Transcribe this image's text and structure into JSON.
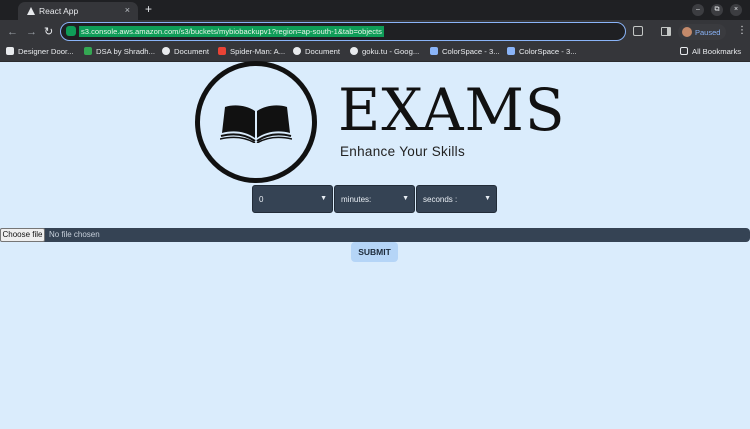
{
  "browser": {
    "tab": {
      "title": "React App",
      "close": "×"
    },
    "new_tab": "+",
    "window": {
      "minimize": "–",
      "restore": "⧉",
      "close": "×"
    },
    "address_bar": {
      "url": "s3.console.aws.amazon.com/s3/buckets/mybiobackupv1?region=ap-south-1&tab=objects"
    },
    "profile": {
      "status": "Paused"
    },
    "bookmarks": [
      {
        "label": "Designer Door...",
        "color": "#e8eaed"
      },
      {
        "label": "DSA by Shradh...",
        "color": "#34a853"
      },
      {
        "label": "Document",
        "color": "#e8eaed"
      },
      {
        "label": "Spider-Man: A...",
        "color": "#ea4335"
      },
      {
        "label": "Document",
        "color": "#e8eaed"
      },
      {
        "label": "goku.tu - Goog...",
        "color": "#e8eaed"
      },
      {
        "label": "ColorSpace - 3...",
        "color": "#8ab4f8"
      },
      {
        "label": "ColorSpace - 3...",
        "color": "#8ab4f8"
      }
    ],
    "all_bookmarks": "All Bookmarks"
  },
  "page": {
    "brand": "EXAMS",
    "tagline": "Enhance Your Skills",
    "timer": {
      "hours": "0",
      "minutes": "minutes:",
      "seconds": "seconds :"
    },
    "file_input": {
      "button": "Choose file",
      "status": "No file chosen"
    },
    "submit": "SUBMIT"
  },
  "colors": {
    "page_background": "#daecfc",
    "select_background": "#354354",
    "submit_background": "#b5d5f7",
    "url_highlight": "#0f9d58"
  }
}
